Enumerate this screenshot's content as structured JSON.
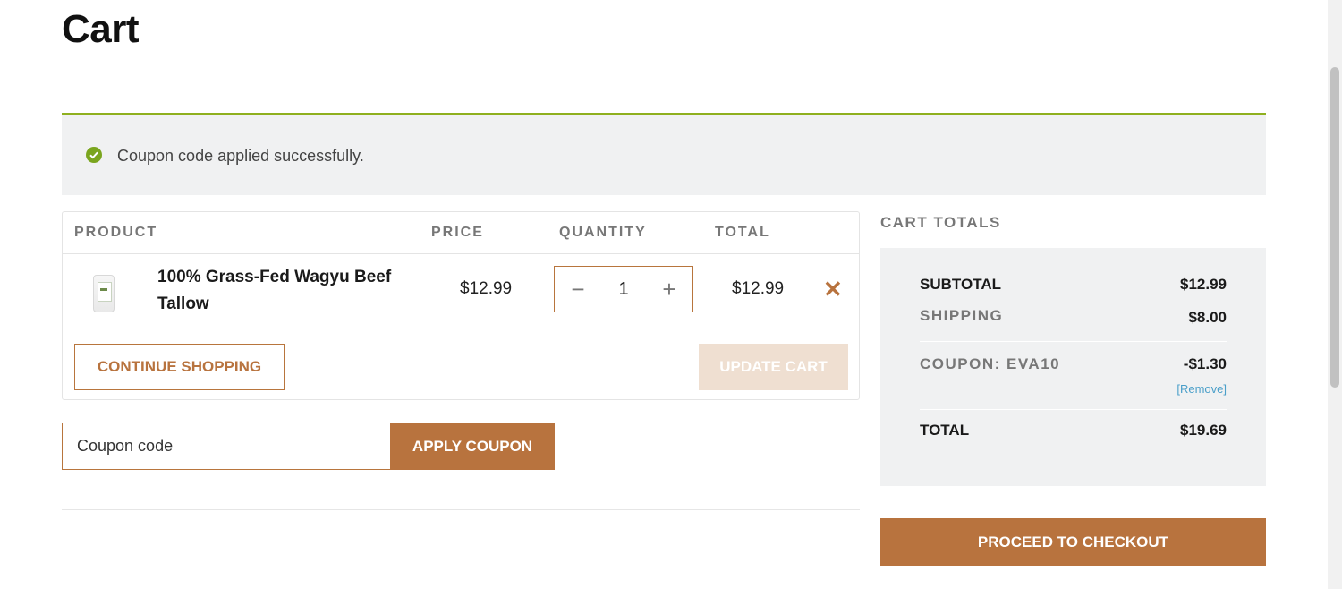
{
  "page": {
    "title": "Cart"
  },
  "notice": {
    "message": "Coupon code applied successfully.",
    "icon": "check-circle-icon",
    "accent_color": "#8fb01f"
  },
  "cart": {
    "headers": {
      "product": "PRODUCT",
      "price": "PRICE",
      "quantity": "QUANTITY",
      "total": "TOTAL"
    },
    "items": [
      {
        "name": "100% Grass-Fed Wagyu Beef Tallow",
        "price": "$12.99",
        "quantity": "1",
        "total": "$12.99",
        "remove_icon": "close-icon"
      }
    ],
    "qty_minus": "−",
    "qty_plus": "+",
    "remove_glyph": "✕",
    "continue_label": "CONTINUE SHOPPING",
    "update_label": "UPDATE CART"
  },
  "coupon": {
    "placeholder": "Coupon code",
    "apply_label": "APPLY COUPON"
  },
  "totals": {
    "heading": "CART TOTALS",
    "subtotal_label": "SUBTOTAL",
    "subtotal_value": "$12.99",
    "shipping_label": "SHIPPING",
    "shipping_value": "$8.00",
    "coupon_label": "COUPON: EVA10",
    "coupon_value": "-$1.30",
    "coupon_remove": "[Remove]",
    "total_label": "TOTAL",
    "total_value": "$19.69",
    "checkout_label": "PROCEED TO CHECKOUT"
  },
  "colors": {
    "brand": "#b8733e",
    "success": "#7aa51e",
    "panel_bg": "#f0f1f2"
  }
}
